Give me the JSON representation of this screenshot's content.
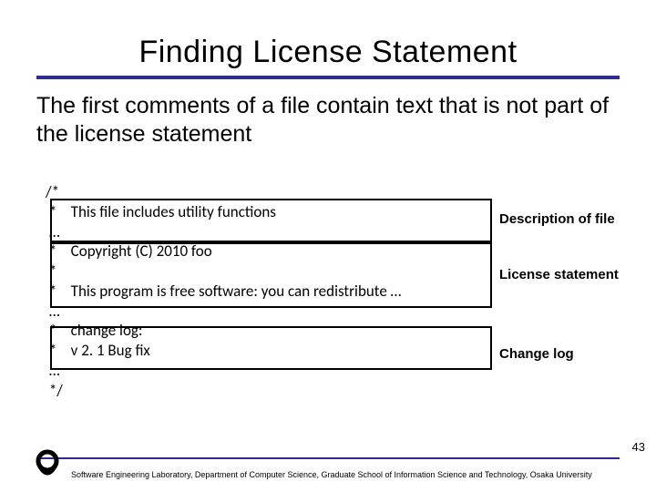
{
  "title": "Finding License Statement",
  "body": "The first comments of a file contain text that is not part of the license statement",
  "comment": {
    "l0": "/*",
    "l1": " *    This file includes utility functions",
    "l2": " …",
    "l3": " *    Copyright (C) 2010 foo",
    "l4": " *",
    "l5": " *    This program is free software: you can redistribute …",
    "l6": " …",
    "l7": " *    change log:",
    "l8": " *    v 2. 1 Bug fix",
    "l9": " …",
    "l10": " */"
  },
  "labels": {
    "desc": "Description of file",
    "license": "License statement",
    "changelog": "Change log"
  },
  "page_number": "43",
  "footer": "Software Engineering Laboratory, Department of Computer Science, Graduate School of Information Science and Technology, Osaka University"
}
